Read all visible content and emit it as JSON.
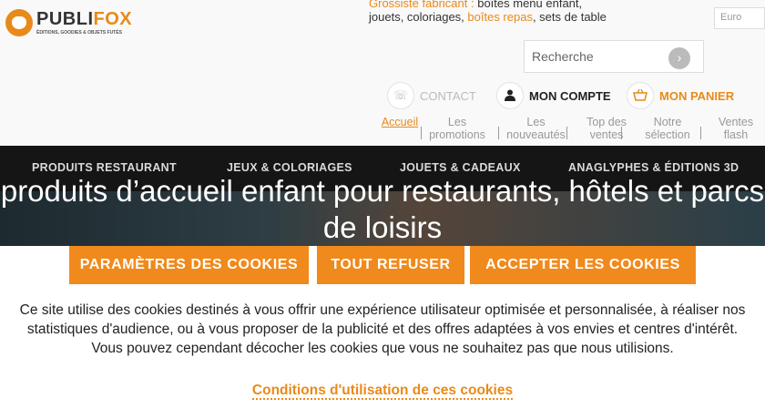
{
  "brand": {
    "name_part1": "PUBLI",
    "name_part2": "FOX",
    "subtitle": "ÉDITIONS, GOODIES & OBJETS FUTÉS"
  },
  "header": {
    "tagline_hl1": "Grossiste fabricant :",
    "tagline_text1": " boîtes menu enfant, jouets, coloriages, ",
    "tagline_hl2": "boîtes repas",
    "tagline_text2": ", sets de table",
    "currency": "Euro",
    "search_placeholder": "Recherche",
    "contact_label": "CONTACT",
    "account_label": "MON COMPTE",
    "cart_label": "MON PANIER"
  },
  "subnav": {
    "items": [
      "Accueil",
      "Les promotions",
      "Les nouveautés",
      "Top des ventes",
      "Notre sélection",
      "Ventes flash"
    ]
  },
  "mainnav": {
    "items": [
      "PRODUITS RESTAURANT",
      "JEUX & COLORIAGES",
      "JOUETS & CADEAUX",
      "ANAGLYPHES & ÉDITIONS 3D"
    ]
  },
  "hero": {
    "title": "produits d’accueil enfant pour restaurants, hôtels et parcs de loisirs"
  },
  "cookies": {
    "settings_label": "PARAMÈTRES DES COOKIES",
    "refuse_label": "TOUT REFUSER",
    "accept_label": "ACCEPTER LES COOKIES",
    "message": "Ce site utilise des cookies destinés à vous offrir une expérience utilisateur optimisée et personnalisée, à réaliser nos statistiques d'audience, ou à vous proposer de la publicité et des offres adaptées à vos envies et centres d'intérêt. Vous pouvez cependant décocher les cookies que vous ne souhaitez pas que nous utilisions.",
    "conditions_label": "Conditions d'utilisation de ces cookies"
  },
  "colors": {
    "accent": "#f08a1c",
    "nav_bg": "#151515"
  },
  "icons": {
    "search": "arrow-right-icon",
    "contact": "phone-icon",
    "account": "user-icon",
    "cart": "basket-icon"
  }
}
